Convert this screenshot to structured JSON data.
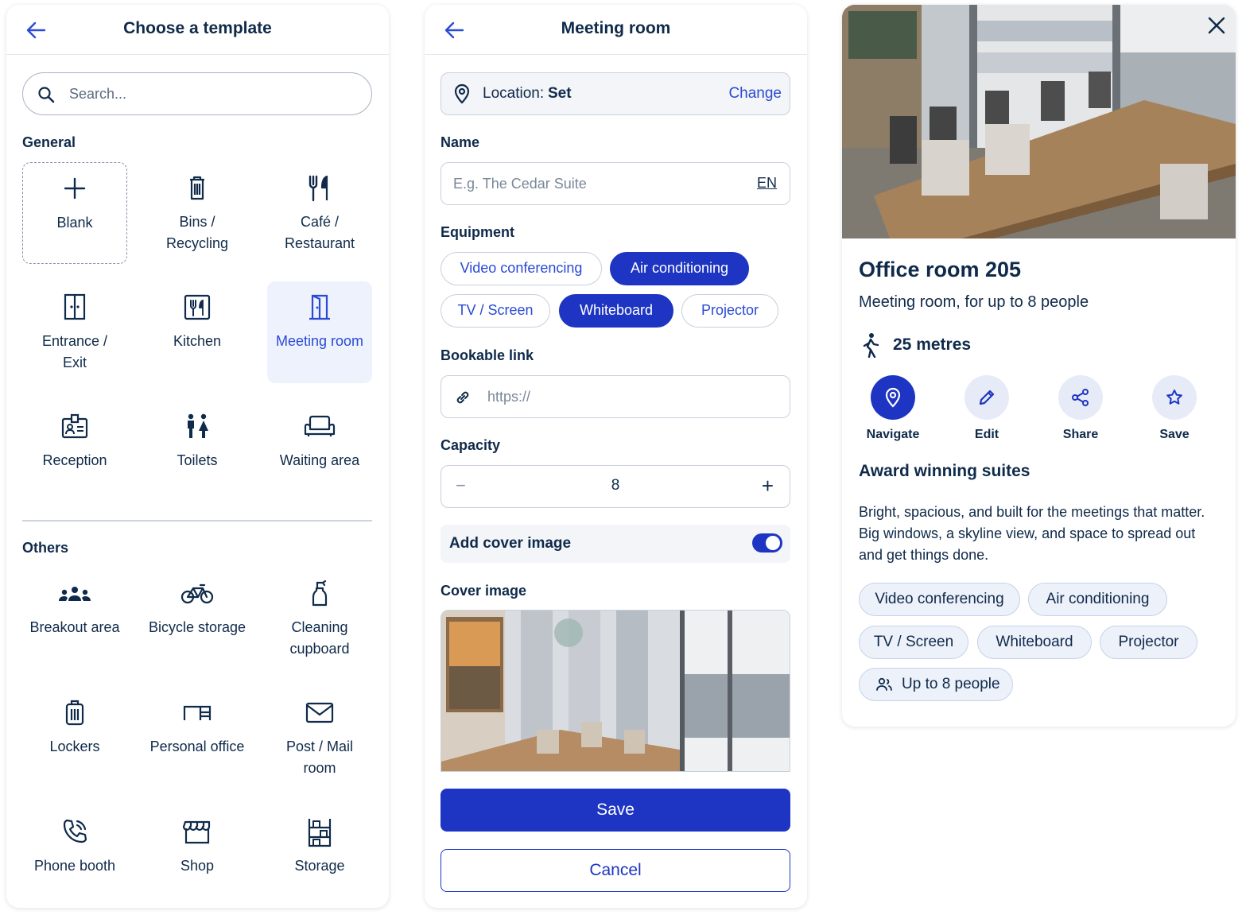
{
  "colors": {
    "accent": "#2a4ad4",
    "primary": "#1d35c2",
    "text": "#0f2a4a"
  },
  "template_panel": {
    "title": "Choose a template",
    "search_placeholder": "Search...",
    "general_label": "General",
    "general_items": [
      {
        "label": "Blank",
        "icon": "plus-icon"
      },
      {
        "label": "Bins /\nRecycling",
        "icon": "bin-icon"
      },
      {
        "label": "Café /\nRestaurant",
        "icon": "cutlery-icon"
      },
      {
        "label": "Entrance /\nExit",
        "icon": "door-icon"
      },
      {
        "label": "Kitchen",
        "icon": "kitchen-icon"
      },
      {
        "label": "Meeting room",
        "icon": "meeting-door-icon",
        "selected": true
      },
      {
        "label": "Reception",
        "icon": "reception-icon"
      },
      {
        "label": "Toilets",
        "icon": "toilets-icon"
      },
      {
        "label": "Waiting area",
        "icon": "sofa-icon"
      }
    ],
    "others_label": "Others",
    "other_items": [
      {
        "label": "Breakout area",
        "icon": "group-icon"
      },
      {
        "label": "Bicycle storage",
        "icon": "bicycle-icon"
      },
      {
        "label": "Cleaning\ncupboard",
        "icon": "spray-bottle-icon"
      },
      {
        "label": "Lockers",
        "icon": "locker-icon"
      },
      {
        "label": "Personal office",
        "icon": "desk-icon"
      },
      {
        "label": "Post / Mail\nroom",
        "icon": "mail-icon"
      },
      {
        "label": "Phone booth",
        "icon": "phone-icon"
      },
      {
        "label": "Shop",
        "icon": "shop-icon"
      },
      {
        "label": "Storage",
        "icon": "shelves-icon"
      }
    ]
  },
  "form_panel": {
    "title": "Meeting room",
    "location_label": "Location:",
    "location_value": "Set",
    "location_change": "Change",
    "name_label": "Name",
    "name_placeholder": "E.g. The Cedar Suite",
    "name_lang": "EN",
    "equipment_label": "Equipment",
    "equipment": [
      {
        "label": "Video conferencing",
        "selected": false
      },
      {
        "label": "Air conditioning",
        "selected": true
      },
      {
        "label": "TV / Screen",
        "selected": false
      },
      {
        "label": "Whiteboard",
        "selected": true
      },
      {
        "label": "Projector",
        "selected": false
      }
    ],
    "link_label": "Bookable link",
    "link_placeholder": "https://",
    "capacity_label": "Capacity",
    "capacity_value": "8",
    "capacity_minus": "−",
    "capacity_plus": "+",
    "cover_toggle_label": "Add cover image",
    "cover_toggle_on": true,
    "cover_label": "Cover image",
    "save_label": "Save",
    "cancel_label": "Cancel"
  },
  "detail_panel": {
    "title": "Office room 205",
    "subtitle": "Meeting room, for up to 8 people",
    "distance": "25 metres",
    "actions": [
      {
        "label": "Navigate",
        "icon": "location-pin-icon"
      },
      {
        "label": "Edit",
        "icon": "pencil-icon"
      },
      {
        "label": "Share",
        "icon": "share-icon"
      },
      {
        "label": "Save",
        "icon": "star-icon"
      }
    ],
    "heading": "Award winning suites",
    "description": "Bright, spacious, and built for the meetings that matter. Big windows, a skyline view, and space to spread out and get things done.",
    "tags": [
      "Video conferencing",
      "Air conditioning",
      "TV / Screen",
      "Whiteboard",
      "Projector"
    ],
    "capacity_tag": "Up to 8 people"
  }
}
